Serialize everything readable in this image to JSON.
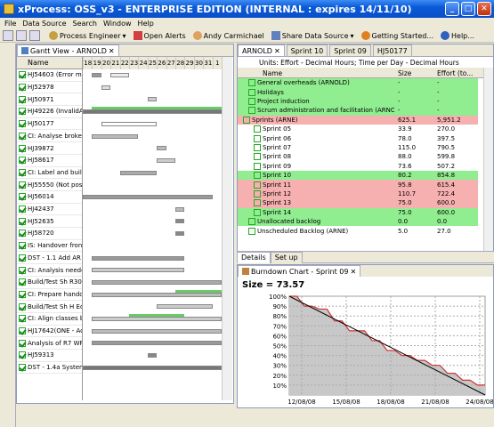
{
  "window": {
    "title": "xProcess: OSS_v3 - ENTERPRISE EDITION  (INTERNAL : expires 14/11/10)"
  },
  "menu": [
    "File",
    "Data Source",
    "Search",
    "Window",
    "Help"
  ],
  "toolbar": {
    "process_engineer": "Process Engineer",
    "open_alerts": "Open Alerts",
    "andy": "Andy Carmichael",
    "share_ds": "Share Data Source",
    "getting_started": "Getting Started...",
    "help": "Help..."
  },
  "gantt": {
    "tab": "Gantt View - ARNOLD",
    "name_header": "Name",
    "days": [
      "18",
      "19",
      "20",
      "21",
      "22",
      "23",
      "24",
      "25",
      "26",
      "27",
      "28",
      "29",
      "30",
      "31",
      "1"
    ],
    "rows": [
      "HJ54603 (Error m",
      "HJ52978",
      "HJ50971",
      "HJ49226 (InvalidA",
      "HJ50177",
      "CI: Analyse broke",
      "HJ39872",
      "HJ58617",
      "CI: Label and buil",
      "HJ55550 (Not pos",
      "HJ56014",
      "HJ42437",
      "HJ52635",
      "HJ58720",
      "IS: Handover fron",
      "DST - 1.1 Add AR",
      "CI: Analysis neede",
      "Build/Test Sh R30",
      "CI: Prepare hando",
      "Build/Test Sh H Ed",
      "CI: Align classes b",
      "HJ17642(ONE - Ac",
      "Analysis of R7 WF",
      "HJ59313",
      "DST - 1.4a System"
    ]
  },
  "tabs2": [
    "ARNOLD",
    "Sprint 10",
    "Sprint 09",
    "HJ50177"
  ],
  "units": "Units: Effort - Decimal Hours; Time per Day - Decimal Hours",
  "table": {
    "headers": [
      "Name",
      "Size",
      "Effort (to..."
    ],
    "rows": [
      {
        "name": "General overheads (ARNOLD)",
        "size": "-",
        "effort": "-",
        "c": "green",
        "i": 1
      },
      {
        "name": "Holidays",
        "size": "-",
        "effort": "-",
        "c": "green",
        "i": 1
      },
      {
        "name": "Project induction",
        "size": "-",
        "effort": "-",
        "c": "green",
        "i": 1
      },
      {
        "name": "Scrum administration and facilitation (ARNOLD)",
        "size": "-",
        "effort": "-",
        "c": "green",
        "i": 1
      },
      {
        "name": "Sprints (ARNE)",
        "size": "625.1",
        "effort": "5,951.2",
        "c": "red",
        "i": 0
      },
      {
        "name": "Sprint 05",
        "size": "33.9",
        "effort": "270.0",
        "c": "",
        "i": 2
      },
      {
        "name": "Sprint 06",
        "size": "78.0",
        "effort": "397.5",
        "c": "",
        "i": 2
      },
      {
        "name": "Sprint 07",
        "size": "115.0",
        "effort": "790.5",
        "c": "",
        "i": 2
      },
      {
        "name": "Sprint 08",
        "size": "88.0",
        "effort": "599.8",
        "c": "",
        "i": 2
      },
      {
        "name": "Sprint 09",
        "size": "73.6",
        "effort": "507.2",
        "c": "",
        "i": 2
      },
      {
        "name": "Sprint 10",
        "size": "80.2",
        "effort": "854.8",
        "c": "green",
        "i": 2
      },
      {
        "name": "Sprint 11",
        "size": "95.8",
        "effort": "615.4",
        "c": "red",
        "i": 2
      },
      {
        "name": "Sprint 12",
        "size": "110.7",
        "effort": "722.4",
        "c": "red",
        "i": 2
      },
      {
        "name": "Sprint 13",
        "size": "75.0",
        "effort": "600.0",
        "c": "red",
        "i": 2
      },
      {
        "name": "Sprint 14",
        "size": "75.0",
        "effort": "600.0",
        "c": "green",
        "i": 2
      },
      {
        "name": "Unallocated backlog",
        "size": "0.0",
        "effort": "0.0",
        "c": "green",
        "i": 1
      },
      {
        "name": "Unscheduled Backlog (ARNE)",
        "size": "5.0",
        "effort": "27.0",
        "c": "",
        "i": 1
      }
    ]
  },
  "bottom_tabs": [
    "Details",
    "Set up"
  ],
  "burndown": {
    "tab": "Burndown Chart - Sprint 09",
    "size_label": "Size = 73.57"
  },
  "chart_data": {
    "type": "line",
    "title": "Size = 73.57",
    "x_labels": [
      "12/08/08",
      "15/08/08",
      "18/08/08",
      "21/08/08",
      "24/08/08"
    ],
    "y_labels": [
      "10%",
      "20%",
      "30%",
      "40%",
      "50%",
      "60%",
      "70%",
      "80%",
      "90%",
      "100%"
    ],
    "ylim": [
      0,
      100
    ],
    "series": [
      {
        "values": [
          100,
          100,
          90,
          90,
          87,
          87,
          75,
          75,
          65,
          65,
          65,
          55,
          55,
          45,
          45,
          40,
          40,
          35,
          35,
          30,
          30,
          22,
          22,
          15,
          15,
          10,
          10
        ]
      }
    ]
  }
}
